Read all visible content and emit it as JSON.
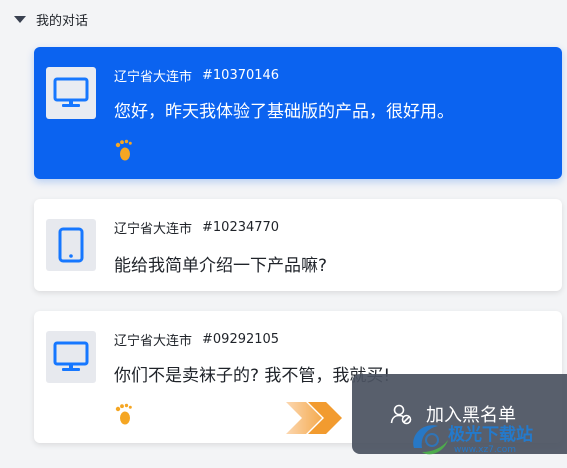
{
  "section": {
    "title": "我的对话"
  },
  "conversations": [
    {
      "device_icon": "monitor-icon",
      "location": "辽宁省大连市",
      "id": "#10370146",
      "message": "您好，昨天我体验了基础版的产品，很好用。",
      "footprint_icon": "footprint-icon",
      "selected": true
    },
    {
      "device_icon": "tablet-icon",
      "location": "辽宁省大连市",
      "id": "#10234770",
      "message": "能给我简单介绍一下产品嘛?"
    },
    {
      "device_icon": "monitor-icon",
      "location": "辽宁省大连市",
      "id": "#09292105",
      "message": "你们不是卖袜子的? 我不管，我就买!",
      "footprint_icon": "footprint-icon"
    }
  ],
  "context_menu": {
    "icon": "user-block-icon",
    "label": "加入黑名单"
  },
  "watermark": {
    "text": "极光下载站",
    "url": "www.xz7.com"
  },
  "colors": {
    "accent": "#0b63f0",
    "device_icon": "#1677ff",
    "footprint": "#f5a623",
    "menu_bg": "#4b5361"
  }
}
